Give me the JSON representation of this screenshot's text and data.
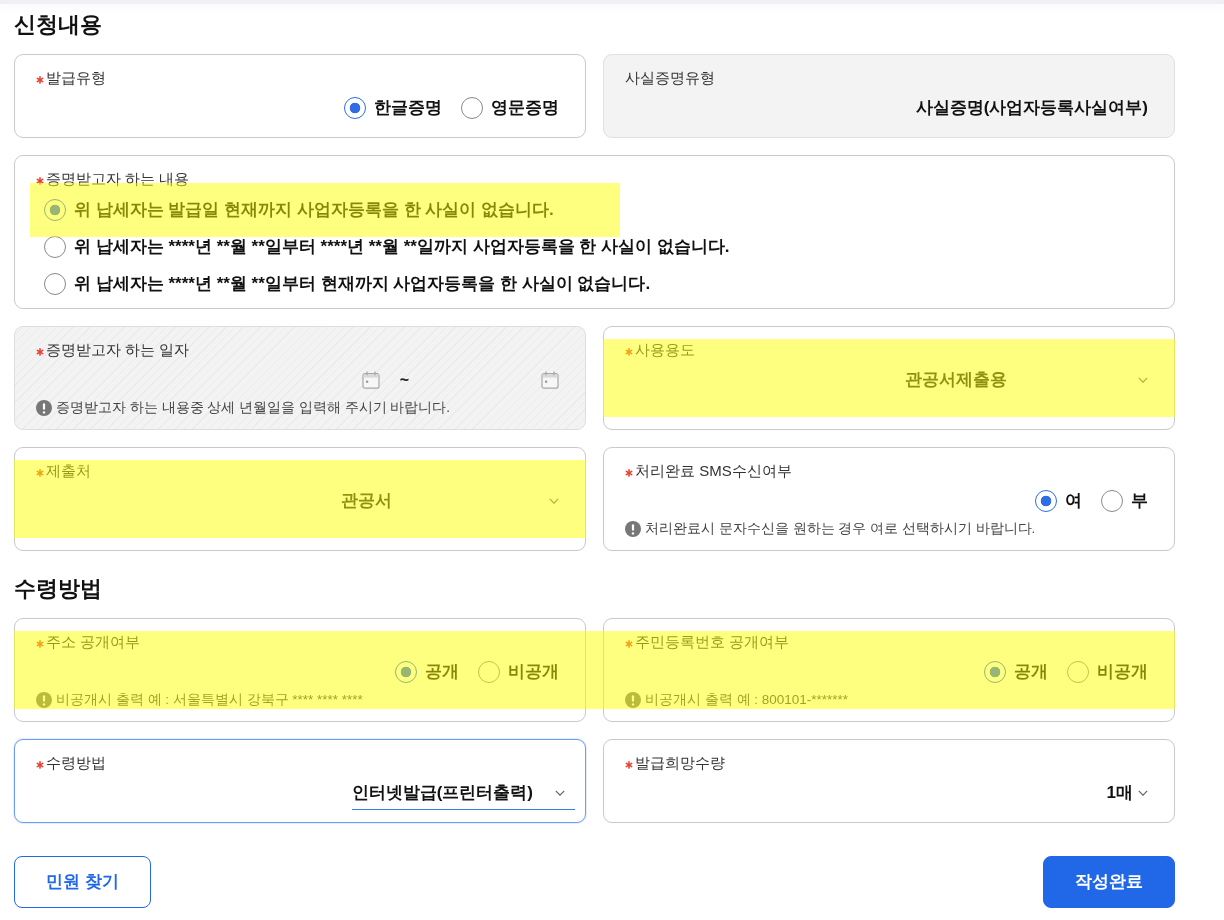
{
  "sections": [
    {
      "title": "신청내용",
      "rows": [
        {
          "fields": [
            {
              "kind": "radio",
              "label": "발급유형",
              "required": true,
              "highlighted": false,
              "options": [
                {
                  "label": "한글증명",
                  "selected": true
                },
                {
                  "label": "영문증명",
                  "selected": false
                }
              ]
            },
            {
              "kind": "static",
              "label": "사실증명유형",
              "required": false,
              "highlighted": false,
              "value": "사실증명(사업자등록사실여부)"
            }
          ]
        },
        {
          "fields": [
            {
              "kind": "list",
              "label": "증명받고자 하는 내용",
              "required": true,
              "options": [
                {
                  "label": "위 납세자는 발급일 현재까지 사업자등록을 한 사실이 없습니다.",
                  "selected": true,
                  "highlighted": true
                },
                {
                  "label": "위 납세자는 ****년 **월 **일부터 ****년 **월 **일까지 사업자등록을 한 사실이 없습니다.",
                  "selected": false,
                  "highlighted": false
                },
                {
                  "label": "위 납세자는 ****년 **월 **일부터 현재까지 사업자등록을 한 사실이 없습니다.",
                  "selected": false,
                  "highlighted": false
                }
              ]
            }
          ]
        },
        {
          "fields": [
            {
              "kind": "daterange",
              "label": "증명받고자 하는 일자",
              "required": true,
              "highlighted": false,
              "disabled": true,
              "separator": "~",
              "hint": "증명받고자 하는 내용중 상세 년월일을 입력해 주시기 바랍니다."
            },
            {
              "kind": "picker",
              "label": "사용용도",
              "required": true,
              "highlighted": true,
              "focused": false,
              "value": "관공서제출용"
            }
          ]
        },
        {
          "fields": [
            {
              "kind": "picker",
              "label": "제출처",
              "required": true,
              "highlighted": true,
              "focused": false,
              "value": "관공서"
            },
            {
              "kind": "radio",
              "label": "처리완료 SMS수신여부",
              "required": true,
              "highlighted": false,
              "options": [
                {
                  "label": "여",
                  "selected": true
                },
                {
                  "label": "부",
                  "selected": false
                }
              ],
              "hint": "처리완료시 문자수신을 원하는 경우 여로 선택하시기 바랍니다."
            }
          ]
        }
      ]
    },
    {
      "title": "수령방법",
      "rows": [
        {
          "fields": [
            {
              "kind": "radio",
              "label": "주소 공개여부",
              "required": true,
              "highlighted": true,
              "options": [
                {
                  "label": "공개",
                  "selected": true
                },
                {
                  "label": "비공개",
                  "selected": false
                }
              ],
              "hint": "비공개시 출력 예 : 서울특별시 강북구 **** **** ****"
            },
            {
              "kind": "radio",
              "label": "주민등록번호 공개여부",
              "required": true,
              "highlighted": true,
              "options": [
                {
                  "label": "공개",
                  "selected": true
                },
                {
                  "label": "비공개",
                  "selected": false
                }
              ],
              "hint": "비공개시 출력 예 : 800101-*******"
            }
          ]
        },
        {
          "fields": [
            {
              "kind": "select",
              "label": "수령방법",
              "required": true,
              "highlighted": false,
              "focused": true,
              "value": "인터넷발급(프린터출력)"
            },
            {
              "kind": "select",
              "label": "발급희망수량",
              "required": true,
              "highlighted": false,
              "focused": false,
              "value": "1매"
            }
          ]
        }
      ]
    }
  ],
  "buttons": [
    {
      "label": "민원 찾기",
      "kind": "outline"
    },
    {
      "label": "작성완료",
      "kind": "primary"
    }
  ]
}
